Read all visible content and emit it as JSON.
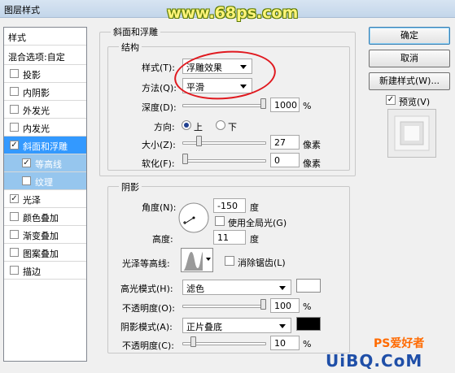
{
  "window": {
    "title": "图层样式"
  },
  "watermark": "www.68ps.com",
  "style_list": {
    "header": "样式",
    "blend": "混合选项:自定",
    "items": [
      {
        "label": "投影",
        "checked": false
      },
      {
        "label": "内阴影",
        "checked": false
      },
      {
        "label": "外发光",
        "checked": false
      },
      {
        "label": "内发光",
        "checked": false
      },
      {
        "label": "斜面和浮雕",
        "checked": true,
        "selected": true
      },
      {
        "label": "等高线",
        "checked": true,
        "sub": true
      },
      {
        "label": "纹理",
        "checked": false,
        "sub": true
      },
      {
        "label": "光泽",
        "checked": true
      },
      {
        "label": "颜色叠加",
        "checked": false
      },
      {
        "label": "渐变叠加",
        "checked": false
      },
      {
        "label": "图案叠加",
        "checked": false
      },
      {
        "label": "描边",
        "checked": false
      }
    ]
  },
  "bevel": {
    "group_title": "斜面和浮雕",
    "structure_title": "结构",
    "style_label": "样式(T):",
    "style_value": "浮雕效果",
    "method_label": "方法(Q):",
    "method_value": "平滑",
    "depth_label": "深度(D):",
    "depth_value": "1000",
    "depth_fraction": 1.0,
    "depth_unit": "%",
    "direction_label": "方向:",
    "dir_up": "上",
    "dir_down": "下",
    "direction": "上",
    "size_label": "大小(Z):",
    "size_value": "27",
    "size_fraction": 0.18,
    "size_unit": "像素",
    "soften_label": "软化(F):",
    "soften_value": "0",
    "soften_fraction": 0.0,
    "soften_unit": "像素"
  },
  "shading": {
    "title": "阴影",
    "angle_label": "角度(N):",
    "angle_value": "-150",
    "angle_unit": "度",
    "global_light_label": "使用全局光(G)",
    "global_light": false,
    "altitude_label": "高度:",
    "altitude_value": "11",
    "altitude_unit": "度",
    "gloss_label": "光泽等高线:",
    "anti_alias_label": "消除锯齿(L)",
    "anti_alias": false,
    "highlight_mode_label": "高光模式(H):",
    "highlight_mode": "滤色",
    "highlight_color": "#ffffff",
    "highlight_opacity_label": "不透明度(O):",
    "highlight_opacity": "100",
    "highlight_opacity_fraction": 1.0,
    "pct": "%",
    "shadow_mode_label": "阴影模式(A):",
    "shadow_mode": "正片叠底",
    "shadow_color": "#000000",
    "shadow_opacity_label": "不透明度(C):",
    "shadow_opacity": "10",
    "shadow_opacity_fraction": 0.1
  },
  "buttons": {
    "ok": "确定",
    "cancel": "取消",
    "new_style": "新建样式(W)...",
    "preview_label": "预览(V)",
    "preview": true
  },
  "footer": {
    "logo": "UiBQ.CoM",
    "logo_sub": "PS爱好者"
  }
}
